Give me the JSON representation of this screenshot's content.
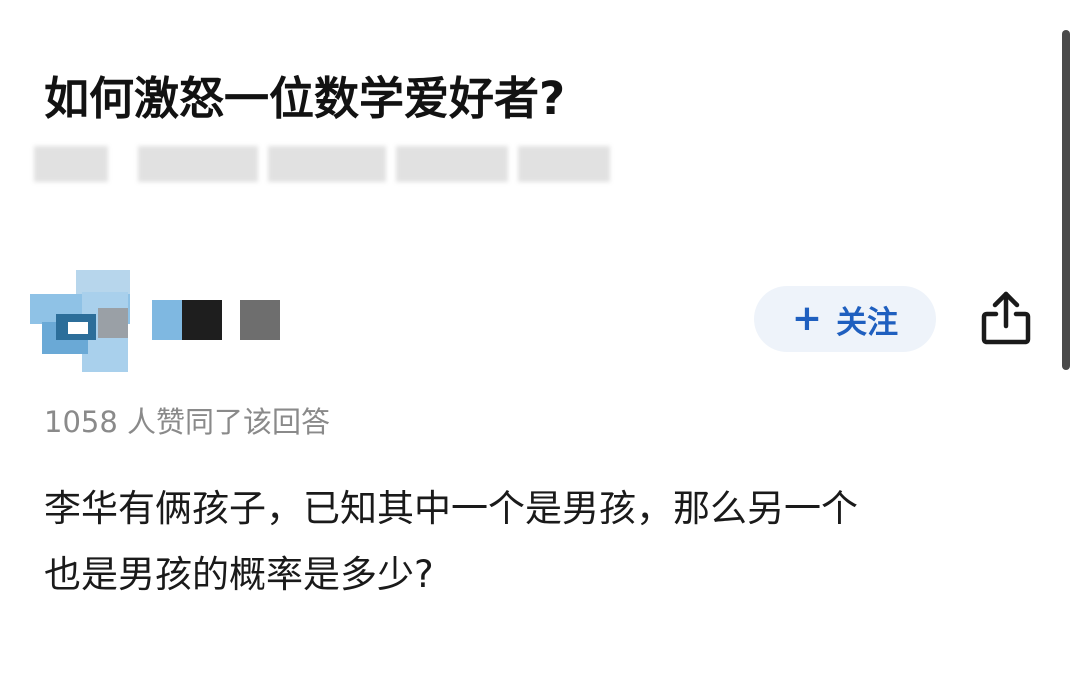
{
  "question": {
    "title": "如何激怒一位数学爱好者?"
  },
  "author": {
    "follow_label": "关注"
  },
  "answer": {
    "vote_text": "1058 人赞同了该回答",
    "body_lines": [
      "李华有俩孩子，已知其中一个是男孩，那么另一个",
      "也是男孩的概率是多少?"
    ]
  },
  "colors": {
    "accent": "#1f5fbf",
    "follow_bg": "#eef3fa",
    "muted_text": "#8a8a8a"
  },
  "icons": {
    "follow": "plus-icon",
    "share": "share-icon"
  }
}
